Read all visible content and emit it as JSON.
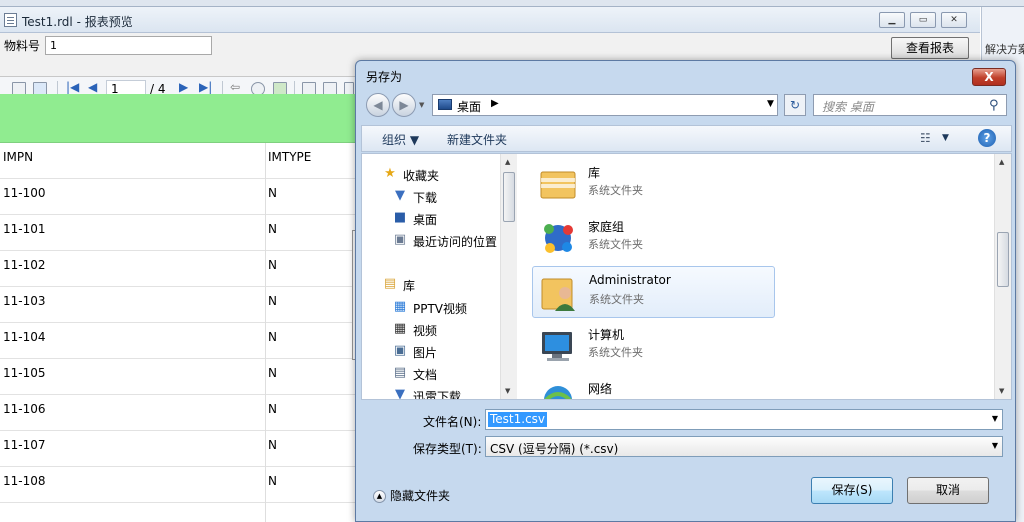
{
  "report_window": {
    "title": "Test1.rdl - 报表预览",
    "param_label": "物料号",
    "param_value": "1",
    "view_button": "查看报表",
    "toolbar": {
      "page_current": "1",
      "page_total": "/ 4"
    },
    "table": {
      "columns": [
        "IMPN",
        "IMTYPE"
      ],
      "rows": [
        [
          "11-100",
          "N"
        ],
        [
          "11-101",
          "N"
        ],
        [
          "11-102",
          "N"
        ],
        [
          "11-103",
          "N"
        ],
        [
          "11-104",
          "N"
        ],
        [
          "11-105",
          "N"
        ],
        [
          "11-106",
          "N"
        ],
        [
          "11-107",
          "N"
        ],
        [
          "11-108",
          "N"
        ]
      ]
    }
  },
  "right_panel": {
    "label": "解决方案"
  },
  "dialog": {
    "title": "另存为",
    "close_label": "X",
    "address": {
      "location": "桌面",
      "arrow": "▶",
      "dropdown": "▼"
    },
    "search_placeholder": "搜索 桌面",
    "commands": {
      "organize": "组织 ▼",
      "new_folder": "新建文件夹",
      "view": "▼"
    },
    "nav_pane": {
      "favorites": [
        "收藏夹",
        "下载",
        "桌面",
        "最近访问的位置"
      ],
      "libraries": [
        "库",
        "PPTV视频",
        "视频",
        "图片",
        "文档",
        "迅雷下载"
      ]
    },
    "files": [
      {
        "name": "库",
        "type": "系统文件夹",
        "icon": "library-icon"
      },
      {
        "name": "家庭组",
        "type": "系统文件夹",
        "icon": "homegroup-icon"
      },
      {
        "name": "Administrator",
        "type": "系统文件夹",
        "icon": "user-folder-icon"
      },
      {
        "name": "计算机",
        "type": "系统文件夹",
        "icon": "computer-icon"
      },
      {
        "name": "网络",
        "type": "",
        "icon": "network-icon"
      }
    ],
    "filename_label": "文件名(N):",
    "filename_value": "Test1.csv",
    "filetype_label": "保存类型(T):",
    "filetype_value": "CSV (逗号分隔) (*.csv)",
    "hide_folders": "隐藏文件夹",
    "save_button": "保存(S)",
    "cancel_button": "取消"
  }
}
